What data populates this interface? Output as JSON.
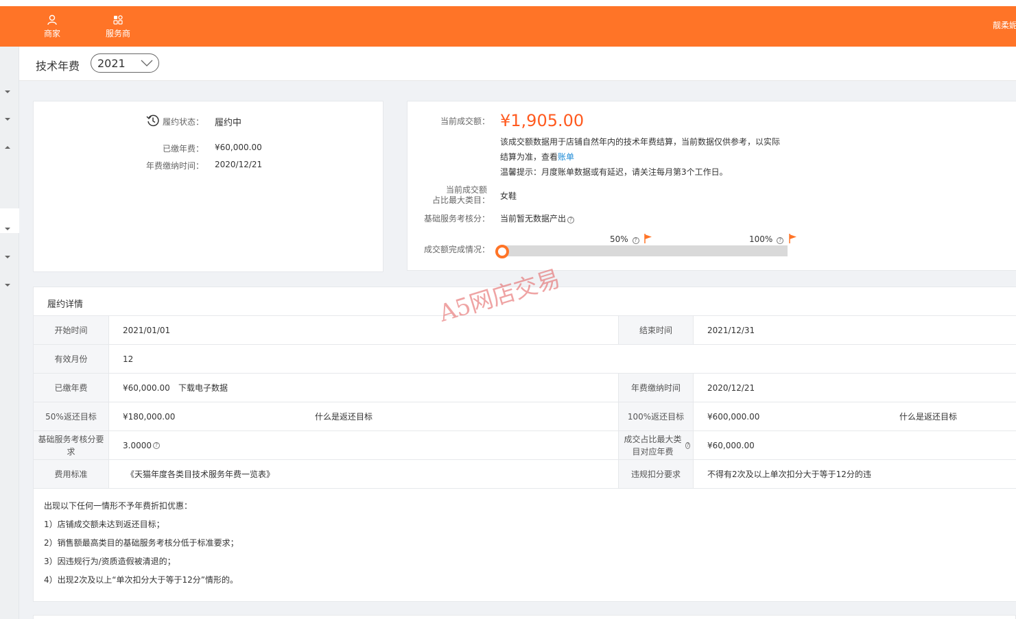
{
  "topnav": {
    "items": [
      {
        "label": "商家",
        "icon": "user-icon"
      },
      {
        "label": "服务商",
        "icon": "grid-icon"
      }
    ],
    "user": "靓柔妮"
  },
  "header": {
    "title": "技术年费",
    "year": "2021"
  },
  "status_card": {
    "status_label": "履约状态：",
    "status_value": "履约中",
    "paid_label": "已缴年费：",
    "paid_value": "¥60,000.00",
    "paid_time_label": "年费缴纳时间：",
    "paid_time_value": "2020/12/21"
  },
  "sales_card": {
    "amount_label": "当前成交额：",
    "amount_value": "¥1,905.00",
    "desc_line1": "该成交额数据用于店铺自然年内的技术年费结算，当前数据仅供参考，以实际",
    "desc_line2_prefix": "结算为准，查看",
    "desc_line2_link": "账单",
    "desc_line3": "温馨提示：月度账单数据或有延迟，请关注每月第3个工作日。",
    "category_label_1": "当前成交额",
    "category_label_2": "占比最大类目：",
    "category_value": "女鞋",
    "score_label": "基础服务考核分：",
    "score_value": "当前暂无数据产出",
    "progress_label": "成交额完成情况：",
    "progress_fraction": 0.003,
    "marker_50": "50%",
    "marker_100": "100%"
  },
  "detail": {
    "title": "履约详情",
    "rows": [
      {
        "l1": "开始时间",
        "v1": "2021/01/01",
        "l2": "结束时间",
        "v2": "2021/12/31"
      },
      {
        "l1": "有效月份",
        "v1": "12"
      },
      {
        "l1": "已缴年费",
        "v1": "¥60,000.00",
        "v1_link": "下载电子数据",
        "l2": "年费缴纳时间",
        "v2": "2020/12/21"
      },
      {
        "l1": "50%返还目标",
        "v1": "¥180,000.00",
        "v1_link": "什么是返还目标",
        "l2": "100%返还目标",
        "v2": "¥600,000.00",
        "v2_link": "什么是返还目标"
      },
      {
        "l1": "基础服务考核分要求",
        "v1": "3.0000",
        "l2": "成交占比最大类目对应年费",
        "v2": "¥60,000.00"
      },
      {
        "l1": "费用标准",
        "v1_link": "《天猫年度各类目技术服务年费一览表》",
        "l2": "违规扣分要求",
        "v2": "不得有2次及以上单次扣分大于等于12分的违"
      }
    ],
    "rules": [
      "出现以下任何一情形不予年费折扣优惠：",
      "1）店铺成交额未达到返还目标；",
      "2）销售额最高类目的基础服务考核分低于标准要求；",
      "3）因违规行为/资质造假被清退的；",
      "4）出现2次及以上“单次扣分大于等于12分”情形的。"
    ]
  },
  "watermark": "A5网店交易",
  "colors": {
    "accent": "#ff7427",
    "amount": "#ff5a1f",
    "link": "#1e8bd6"
  }
}
